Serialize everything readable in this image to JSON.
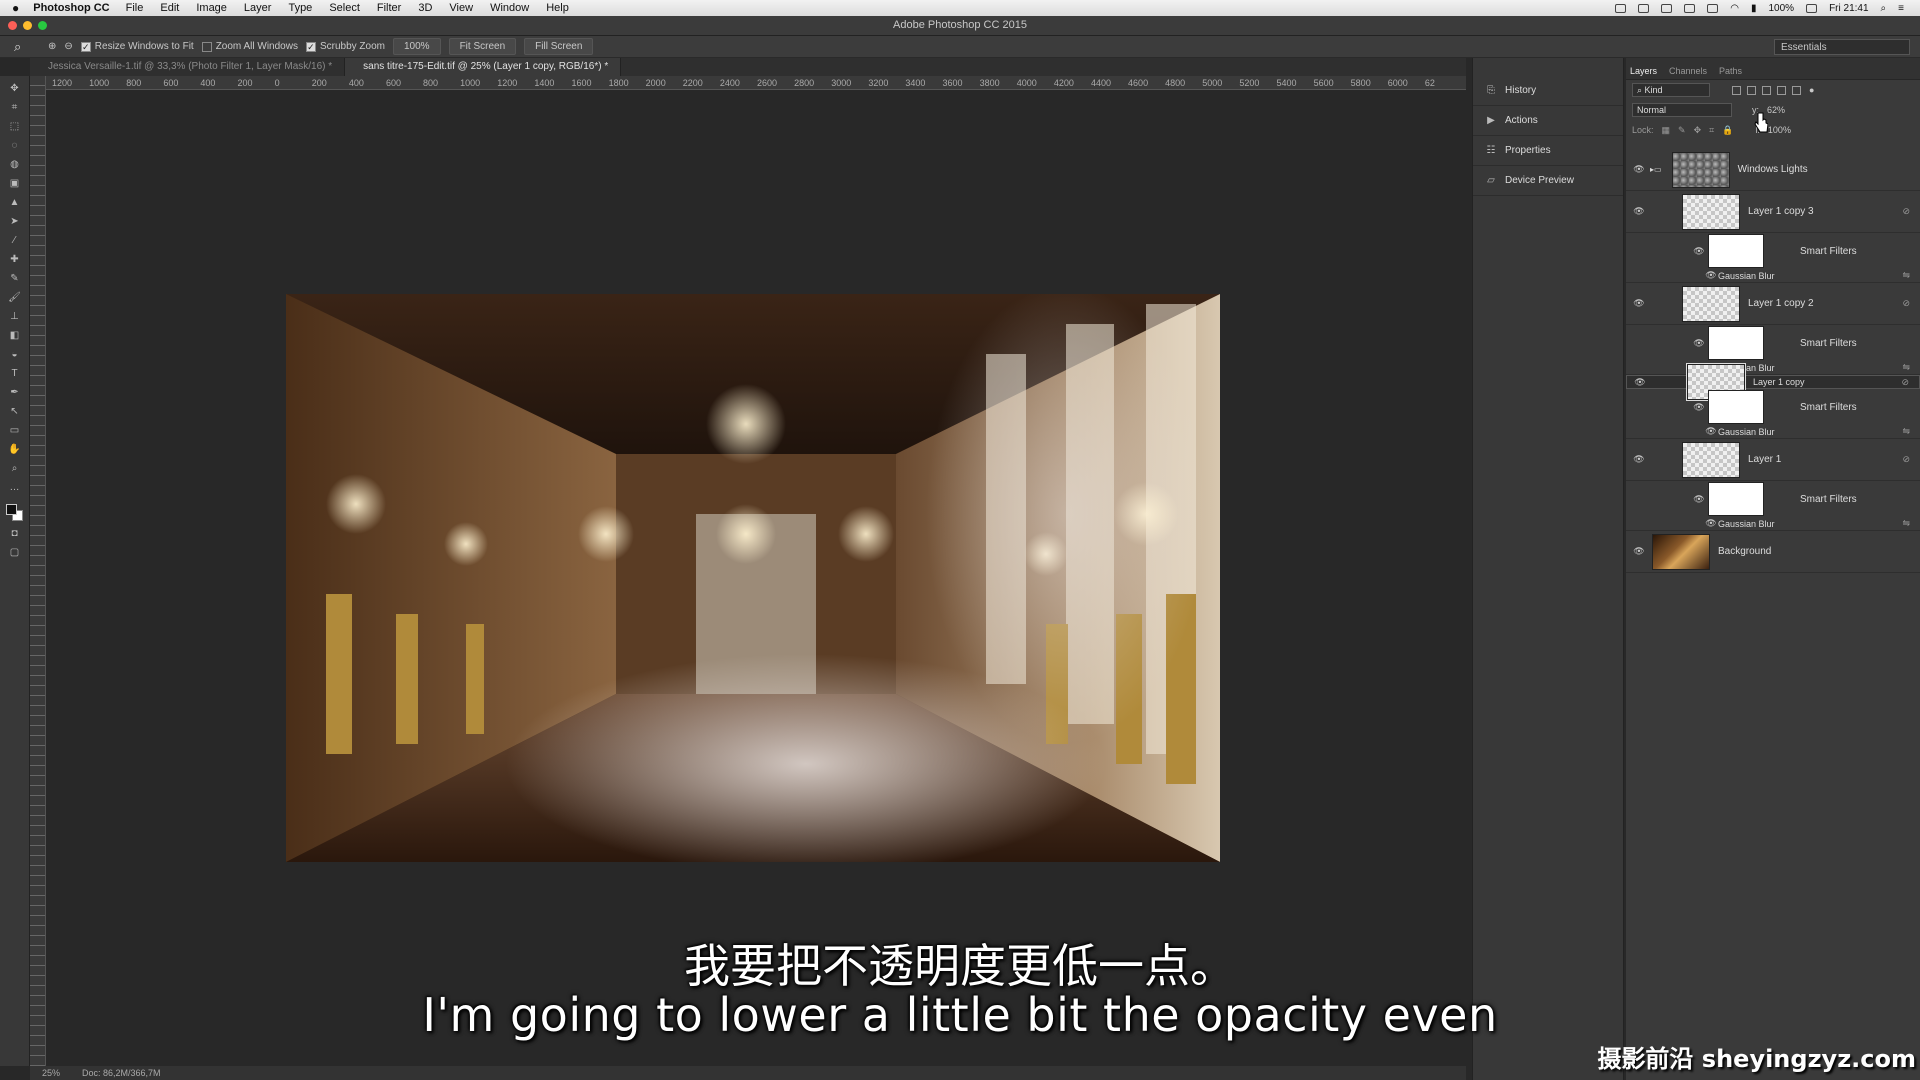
{
  "menubar": {
    "app": "Photoshop CC",
    "items": [
      "File",
      "Edit",
      "Image",
      "Layer",
      "Type",
      "Select",
      "Filter",
      "3D",
      "View",
      "Window",
      "Help"
    ],
    "battery": "100%",
    "clock": "Fri 21:41"
  },
  "window": {
    "title": "Adobe Photoshop CC 2015"
  },
  "options": {
    "resize_windows": "Resize Windows to Fit",
    "zoom_all": "Zoom All Windows",
    "scrubby": "Scrubby Zoom",
    "zoom_level": "100%",
    "fit_screen": "Fit Screen",
    "fill_screen": "Fill Screen",
    "workspace": "Essentials"
  },
  "tabs": [
    {
      "label": "Jessica Versaille-1.tif @ 33,3% (Photo Filter 1, Layer Mask/16) *"
    },
    {
      "label": "sans titre-175-Edit.tif @ 25% (Layer 1 copy, RGB/16*) *"
    }
  ],
  "ruler_h": [
    "1200",
    "1000",
    "800",
    "600",
    "400",
    "200",
    "0",
    "200",
    "400",
    "600",
    "800",
    "1000",
    "1200",
    "1400",
    "1600",
    "1800",
    "2000",
    "2200",
    "2400",
    "2600",
    "2800",
    "3000",
    "3200",
    "3400",
    "3600",
    "3800",
    "4000",
    "4200",
    "4400",
    "4600",
    "4800",
    "5000",
    "5200",
    "5400",
    "5600",
    "5800",
    "6000",
    "62"
  ],
  "status": {
    "zoom": "25%",
    "doc": "Doc: 86,2M/366,7M"
  },
  "midpanel": {
    "history": "History",
    "actions": "Actions",
    "properties": "Properties",
    "device_preview": "Device Preview"
  },
  "layers_panel": {
    "tabs": [
      "Layers",
      "Channels",
      "Paths"
    ],
    "filter": "Kind",
    "blend_mode": "Normal",
    "opacity_label": "y:",
    "opacity": "62%",
    "lock_label": "Lock:",
    "fill_label": "l:",
    "fill": "100%",
    "rows": [
      {
        "kind": "group",
        "name": "Windows Lights"
      },
      {
        "kind": "layer",
        "name": "Layer 1 copy 3"
      },
      {
        "kind": "smartfilters",
        "name": "Smart Filters"
      },
      {
        "kind": "blur",
        "name": "Gaussian Blur"
      },
      {
        "kind": "layer",
        "name": "Layer 1 copy 2"
      },
      {
        "kind": "smartfilters",
        "name": "Smart Filters"
      },
      {
        "kind": "blur",
        "name": "Gaussian Blur"
      },
      {
        "kind": "layer",
        "name": "Layer 1 copy",
        "selected": true
      },
      {
        "kind": "smartfilters",
        "name": "Smart Filters"
      },
      {
        "kind": "blur",
        "name": "Gaussian Blur"
      },
      {
        "kind": "layer",
        "name": "Layer 1"
      },
      {
        "kind": "smartfilters",
        "name": "Smart Filters"
      },
      {
        "kind": "blur",
        "name": "Gaussian Blur"
      },
      {
        "kind": "background",
        "name": "Background"
      }
    ]
  },
  "subtitles": {
    "cn": "我要把不透明度更低一点。",
    "en": "I'm going to lower a little bit the opacity even"
  },
  "watermark": "摄影前沿 sheyingzyz.com"
}
